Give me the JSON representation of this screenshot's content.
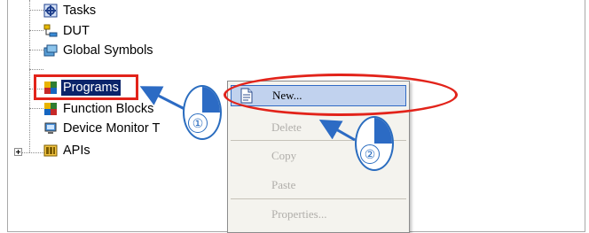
{
  "tree": {
    "items": [
      {
        "label": "Tasks",
        "icon": "tasks-icon"
      },
      {
        "label": "DUT",
        "icon": "dut-icon"
      },
      {
        "label": "Global Symbols",
        "icon": "global-symbols-icon"
      },
      {
        "label": "Programs",
        "icon": "programs-icon",
        "selected": true
      },
      {
        "label": "Function Blocks",
        "icon": "function-blocks-icon"
      },
      {
        "label": "Device Monitor T",
        "icon": "device-monitor-icon"
      },
      {
        "label": "APIs",
        "icon": "apis-icon",
        "expandable": true
      }
    ]
  },
  "context_menu": {
    "items": [
      {
        "label": "New...",
        "enabled": true,
        "highlighted": true,
        "icon": "new-document-icon"
      },
      {
        "label": "Delete",
        "enabled": false
      },
      {
        "label": "Copy",
        "enabled": false
      },
      {
        "label": "Paste",
        "enabled": false
      },
      {
        "label": "Properties...",
        "enabled": false
      }
    ]
  },
  "annotations": {
    "step1": "①",
    "step2": "②",
    "highlight_color": "#e2231a",
    "callout_color": "#2c6bc4"
  }
}
